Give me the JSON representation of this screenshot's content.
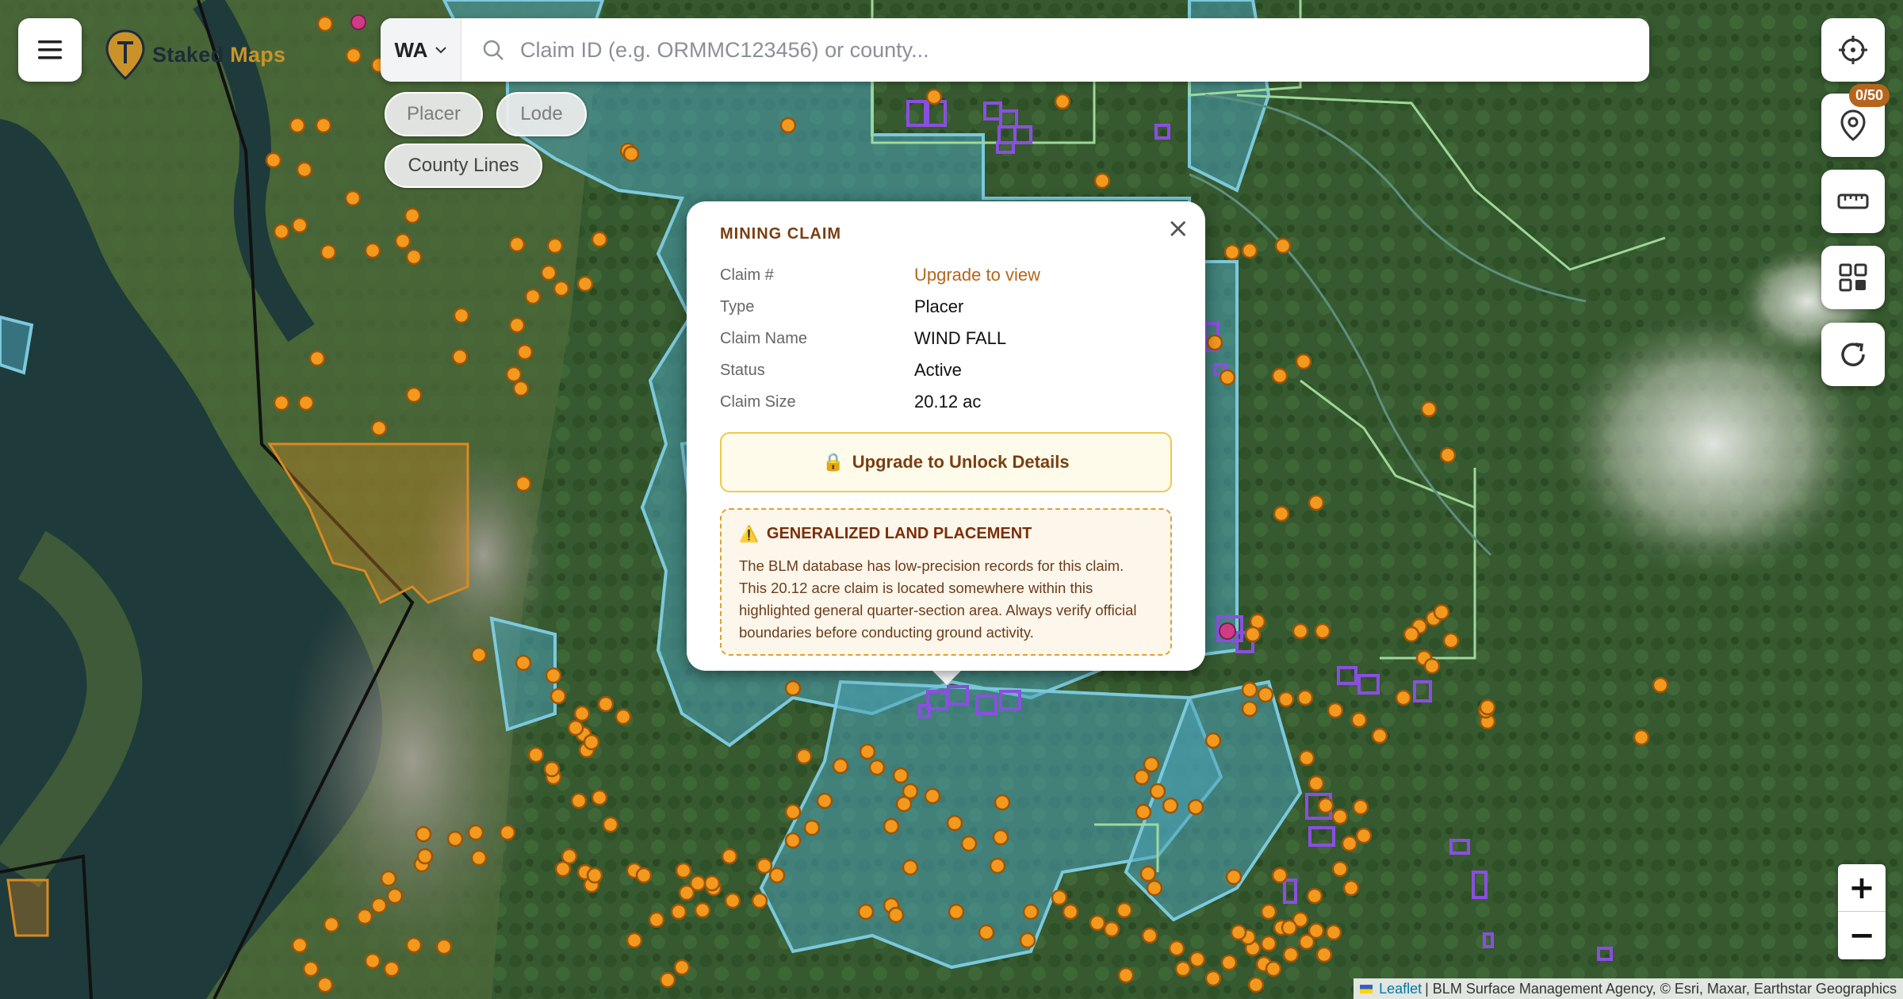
{
  "app": {
    "logo_word1": "Staked",
    "logo_word2": "Maps",
    "brand_navy": "#1d2b3a",
    "brand_gold": "#c9932a"
  },
  "search": {
    "state": "WA",
    "placeholder": "Claim ID (e.g. ORMMC123456) or county..."
  },
  "filters": [
    {
      "label": "Placer",
      "active": false
    },
    {
      "label": "Lode",
      "active": false
    },
    {
      "label": "County Lines",
      "active": true
    }
  ],
  "right_controls": {
    "saved_count": "0/50",
    "items": [
      "locate-icon",
      "saved-pin-icon",
      "ruler-icon",
      "layers-grid-icon",
      "refresh-icon"
    ]
  },
  "popup": {
    "title": "MINING CLAIM",
    "close_symbol": "×",
    "rows": [
      {
        "label": "Claim #",
        "value": "Upgrade to view"
      },
      {
        "label": "Type",
        "value": "Placer"
      },
      {
        "label": "Claim Name",
        "value": "WIND FALL"
      },
      {
        "label": "Status",
        "value": "Active"
      },
      {
        "label": "Claim Size",
        "value": "20.12 ac"
      }
    ],
    "unlock_icon": "🔒",
    "unlock_label": "Upgrade to Unlock Details",
    "warning_icon": "⚠️",
    "warning_title": "GENERALIZED LAND PLACEMENT",
    "warning_text": "The BLM database has low-precision records for this claim. This 20.12 acre claim is located somewhere within this highlighted general quarter-section area. Always verify official boundaries before conducting ground activity."
  },
  "zoom": {
    "in": "+",
    "out": "−"
  },
  "attribution": {
    "link": "Leaflet",
    "text": "| BLM Surface Management Agency, © Esri, Maxar, Earthstar Geographics"
  },
  "map_colors": {
    "forest": "#36592f",
    "water": "#1f3a3a",
    "blm_fill": "#4aa3b8",
    "claim_marker": "#f2991e",
    "lode_box": "#8a4fe0",
    "highlight": "#d98a22"
  }
}
